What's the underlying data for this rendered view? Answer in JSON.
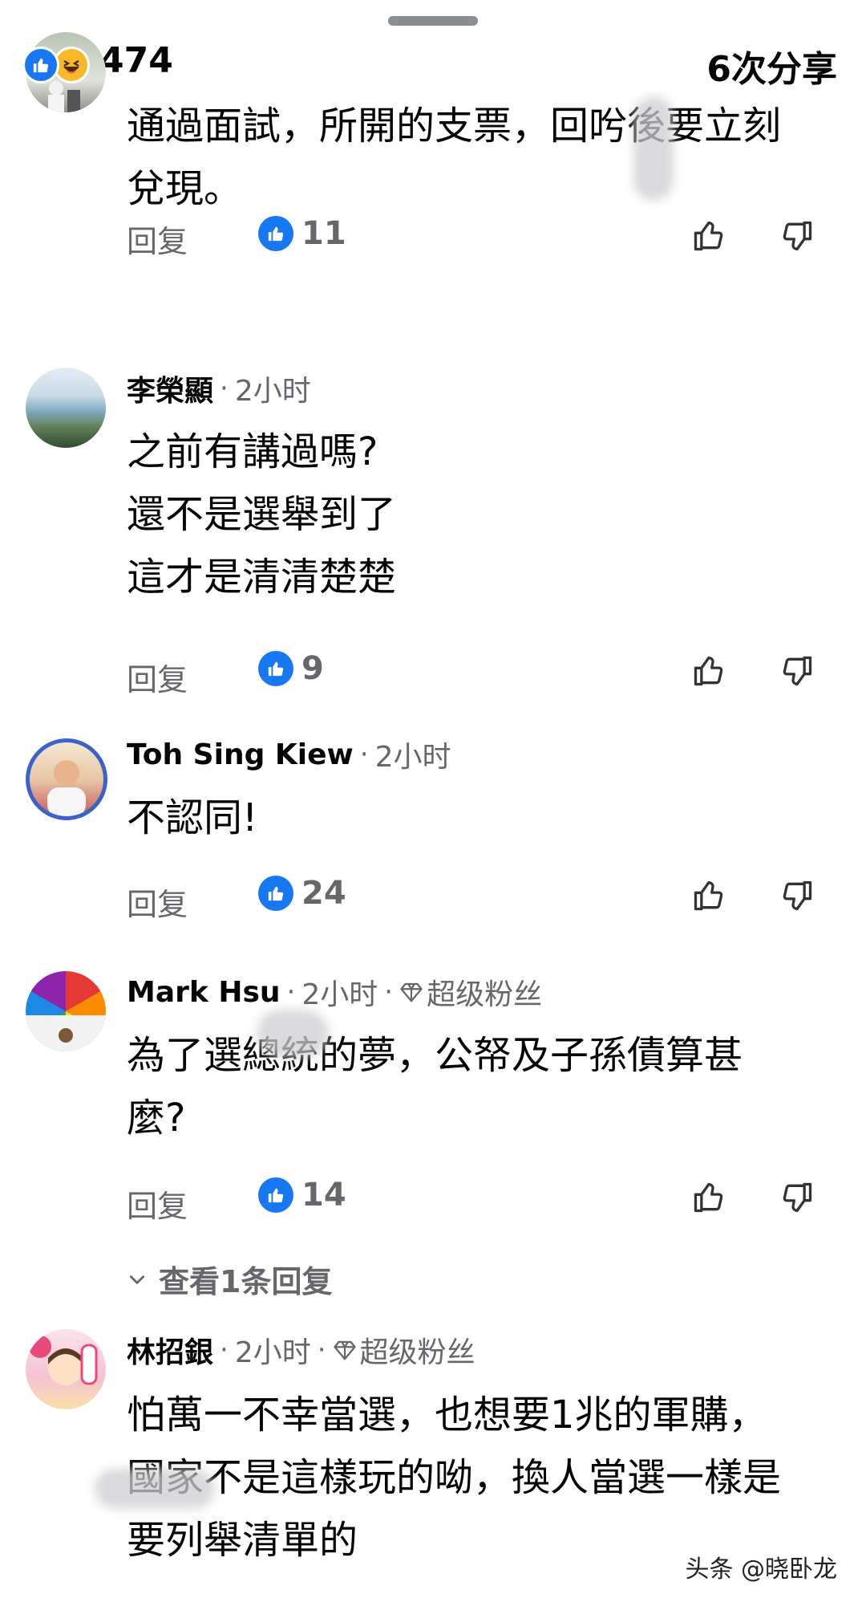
{
  "header": {
    "reaction_count": "474",
    "shares": "6次分享",
    "reactions": [
      "like-icon",
      "haha-icon"
    ]
  },
  "comments": [
    {
      "author": "",
      "time": "",
      "lines": [
        "通過面試，所開的支票，回𠯋後要立刻",
        "兌現。"
      ],
      "reply_label": "回复",
      "likes": "11"
    },
    {
      "author": "李榮顯",
      "time": "2小时",
      "lines": [
        "之前有講過嗎?",
        "還不是選舉到了",
        "這才是清清楚楚"
      ],
      "reply_label": "回复",
      "likes": "9"
    },
    {
      "author": "Toh Sing Kiew",
      "time": "2小时",
      "lines": [
        "不認同!"
      ],
      "reply_label": "回复",
      "likes": "24"
    },
    {
      "author": "Mark Hsu",
      "time": "2小时",
      "badge": "超级粉丝",
      "lines": [
        "為了選總統的夢，公帑及子孫債算甚",
        "麼?"
      ],
      "reply_label": "回复",
      "likes": "14",
      "view_replies": "查看1条回复"
    },
    {
      "author": "林招銀",
      "time": "2小时",
      "badge": "超级粉丝",
      "lines": [
        "怕萬一不幸當選，也想要1兆的軍購，",
        "國家不是這樣玩的呦，換人當選一樣是",
        "要列舉清單的"
      ]
    }
  ],
  "watermark": "头条 @晓卧龙",
  "colors": {
    "accent": "#1877f2",
    "secondary_text": "#65676b",
    "text": "#050505"
  }
}
